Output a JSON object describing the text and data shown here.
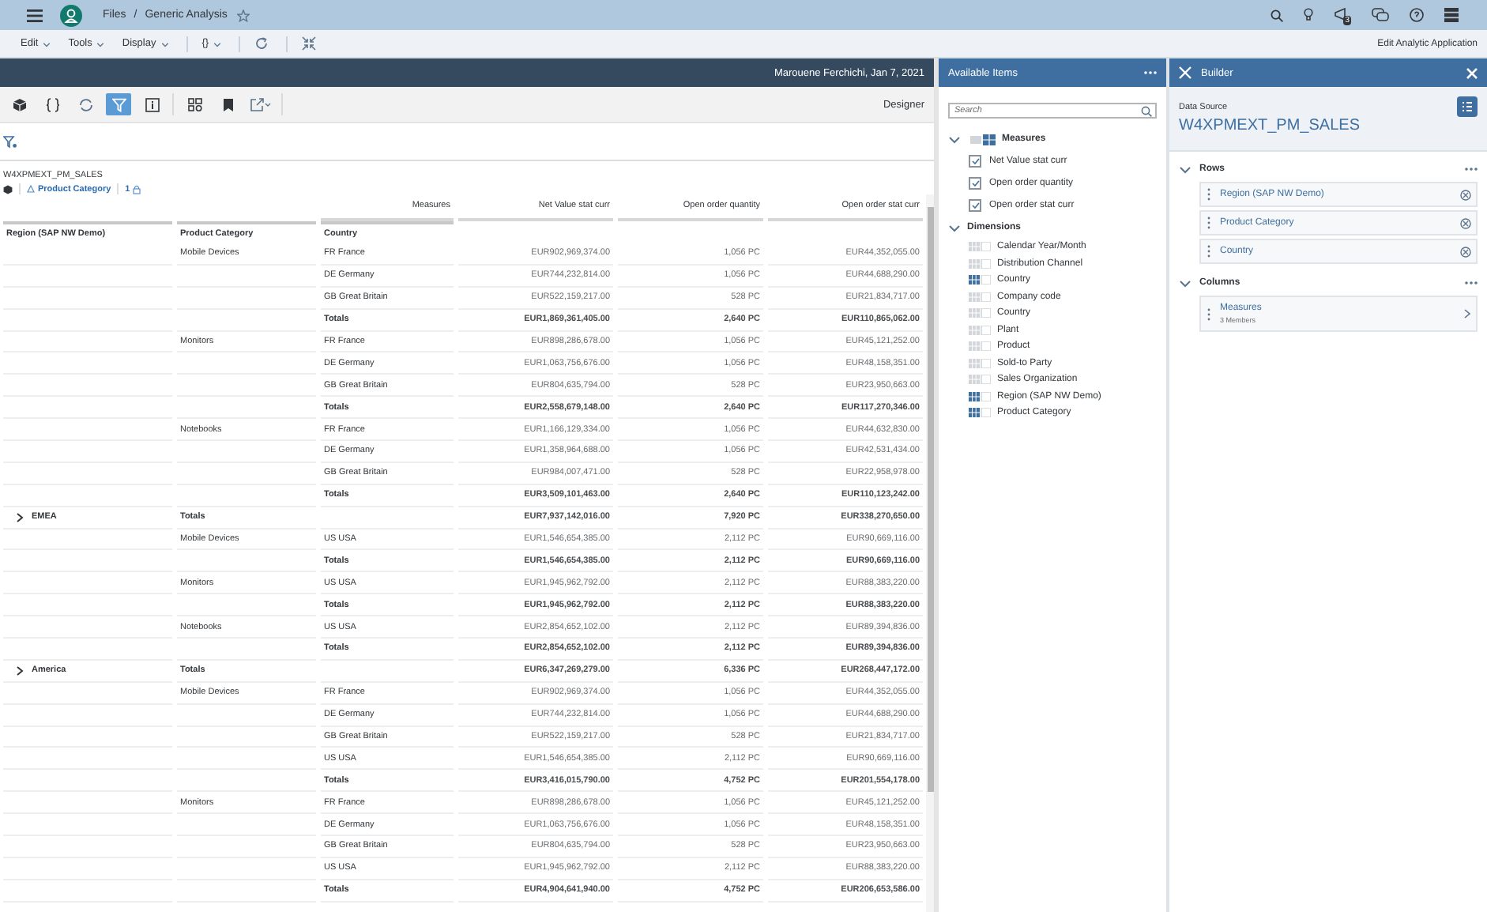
{
  "shell": {
    "breadcrumb": [
      "Files",
      "Generic Analysis"
    ],
    "separator": "/",
    "notification_count": "3"
  },
  "menu_bar": {
    "items": [
      {
        "label": "Edit",
        "kind": "dropdown"
      },
      {
        "label": "Tools",
        "kind": "dropdown"
      },
      {
        "label": "Display",
        "kind": "dropdown"
      },
      {
        "label": "{}",
        "kind": "dropdown"
      },
      {
        "kind": "refresh"
      },
      {
        "kind": "fullscreen"
      }
    ],
    "right_link": "Edit Analytic Application"
  },
  "header_bar": {
    "text": "Marouene Ferchichi, Jan 7, 2021"
  },
  "toolbar": {
    "items": [
      {
        "kind": "cube",
        "selected": false
      },
      {
        "kind": "braces",
        "selected": false
      },
      {
        "kind": "refresh",
        "selected": false
      },
      {
        "kind": "filter",
        "selected": true
      },
      {
        "kind": "info",
        "selected": false
      },
      {
        "kind": "grid",
        "selected": false
      },
      {
        "kind": "bookmark",
        "selected": false
      },
      {
        "kind": "share",
        "selected": false
      }
    ],
    "designer_link": "Designer"
  },
  "table": {
    "source": "W4XPMEXT_PM_SALES",
    "filter_chip": "Product Category",
    "filter_count": "1",
    "measures_label": "Measures",
    "measure_columns": [
      "Net Value stat curr",
      "Open order quantity",
      "Open order stat curr"
    ],
    "dimension_columns": [
      "Region (SAP NW Demo)",
      "Product Category",
      "Country"
    ],
    "rows": [
      {
        "kind": "detail",
        "region": "",
        "category": "Mobile Devices",
        "country": "FR France",
        "values": [
          "EUR902,969,374.00",
          "1,056 PC",
          "EUR44,352,055.00"
        ]
      },
      {
        "kind": "detail",
        "region": "",
        "category": "",
        "country": "DE Germany",
        "values": [
          "EUR744,232,814.00",
          "1,056 PC",
          "EUR44,688,290.00"
        ]
      },
      {
        "kind": "detail",
        "region": "",
        "category": "",
        "country": "GB Great Britain",
        "values": [
          "EUR522,159,217.00",
          "528 PC",
          "EUR21,834,717.00"
        ]
      },
      {
        "kind": "total",
        "region": "",
        "category": "",
        "country": "Totals",
        "values": [
          "EUR1,869,361,405.00",
          "2,640 PC",
          "EUR110,865,062.00"
        ]
      },
      {
        "kind": "detail",
        "region": "",
        "category": "Monitors",
        "country": "FR France",
        "values": [
          "EUR898,286,678.00",
          "1,056 PC",
          "EUR45,121,252.00"
        ]
      },
      {
        "kind": "detail",
        "region": "",
        "category": "",
        "country": "DE Germany",
        "values": [
          "EUR1,063,756,676.00",
          "1,056 PC",
          "EUR48,158,351.00"
        ]
      },
      {
        "kind": "detail",
        "region": "",
        "category": "",
        "country": "GB Great Britain",
        "values": [
          "EUR804,635,794.00",
          "528 PC",
          "EUR23,950,663.00"
        ]
      },
      {
        "kind": "total",
        "region": "",
        "category": "",
        "country": "Totals",
        "values": [
          "EUR2,558,679,148.00",
          "2,640 PC",
          "EUR117,270,346.00"
        ]
      },
      {
        "kind": "detail",
        "region": "",
        "category": "Notebooks",
        "country": "FR France",
        "values": [
          "EUR1,166,129,334.00",
          "1,056 PC",
          "EUR44,632,830.00"
        ]
      },
      {
        "kind": "detail",
        "region": "",
        "category": "",
        "country": "DE Germany",
        "values": [
          "EUR1,358,964,688.00",
          "1,056 PC",
          "EUR42,531,434.00"
        ]
      },
      {
        "kind": "detail",
        "region": "",
        "category": "",
        "country": "GB Great Britain",
        "values": [
          "EUR984,007,471.00",
          "528 PC",
          "EUR22,958,978.00"
        ]
      },
      {
        "kind": "total",
        "region": "",
        "category": "",
        "country": "Totals",
        "values": [
          "EUR3,509,101,463.00",
          "2,640 PC",
          "EUR110,123,242.00"
        ]
      },
      {
        "kind": "region",
        "region": "EMEA",
        "category": "Totals",
        "country": "",
        "values": [
          "EUR7,937,142,016.00",
          "7,920 PC",
          "EUR338,270,650.00"
        ]
      },
      {
        "kind": "detail",
        "region": "",
        "category": "Mobile Devices",
        "country": "US USA",
        "values": [
          "EUR1,546,654,385.00",
          "2,112 PC",
          "EUR90,669,116.00"
        ]
      },
      {
        "kind": "total",
        "region": "",
        "category": "",
        "country": "Totals",
        "values": [
          "EUR1,546,654,385.00",
          "2,112 PC",
          "EUR90,669,116.00"
        ]
      },
      {
        "kind": "detail",
        "region": "",
        "category": "Monitors",
        "country": "US USA",
        "values": [
          "EUR1,945,962,792.00",
          "2,112 PC",
          "EUR88,383,220.00"
        ]
      },
      {
        "kind": "total",
        "region": "",
        "category": "",
        "country": "Totals",
        "values": [
          "EUR1,945,962,792.00",
          "2,112 PC",
          "EUR88,383,220.00"
        ]
      },
      {
        "kind": "detail",
        "region": "",
        "category": "Notebooks",
        "country": "US USA",
        "values": [
          "EUR2,854,652,102.00",
          "2,112 PC",
          "EUR89,394,836.00"
        ]
      },
      {
        "kind": "total",
        "region": "",
        "category": "",
        "country": "Totals",
        "values": [
          "EUR2,854,652,102.00",
          "2,112 PC",
          "EUR89,394,836.00"
        ]
      },
      {
        "kind": "region",
        "region": "America",
        "category": "Totals",
        "country": "",
        "values": [
          "EUR6,347,269,279.00",
          "6,336 PC",
          "EUR268,447,172.00"
        ]
      },
      {
        "kind": "detail",
        "region": "",
        "category": "Mobile Devices",
        "country": "FR France",
        "values": [
          "EUR902,969,374.00",
          "1,056 PC",
          "EUR44,352,055.00"
        ]
      },
      {
        "kind": "detail",
        "region": "",
        "category": "",
        "country": "DE Germany",
        "values": [
          "EUR744,232,814.00",
          "1,056 PC",
          "EUR44,688,290.00"
        ]
      },
      {
        "kind": "detail",
        "region": "",
        "category": "",
        "country": "GB Great Britain",
        "values": [
          "EUR522,159,217.00",
          "528 PC",
          "EUR21,834,717.00"
        ]
      },
      {
        "kind": "detail",
        "region": "",
        "category": "",
        "country": "US USA",
        "values": [
          "EUR1,546,654,385.00",
          "2,112 PC",
          "EUR90,669,116.00"
        ]
      },
      {
        "kind": "total",
        "region": "",
        "category": "",
        "country": "Totals",
        "values": [
          "EUR3,416,015,790.00",
          "4,752 PC",
          "EUR201,554,178.00"
        ]
      },
      {
        "kind": "detail",
        "region": "",
        "category": "Monitors",
        "country": "FR France",
        "values": [
          "EUR898,286,678.00",
          "1,056 PC",
          "EUR45,121,252.00"
        ]
      },
      {
        "kind": "detail",
        "region": "",
        "category": "",
        "country": "DE Germany",
        "values": [
          "EUR1,063,756,676.00",
          "1,056 PC",
          "EUR48,158,351.00"
        ]
      },
      {
        "kind": "detail",
        "region": "",
        "category": "",
        "country": "GB Great Britain",
        "values": [
          "EUR804,635,794.00",
          "528 PC",
          "EUR23,950,663.00"
        ]
      },
      {
        "kind": "detail",
        "region": "",
        "category": "",
        "country": "US USA",
        "values": [
          "EUR1,945,962,792.00",
          "2,112 PC",
          "EUR88,383,220.00"
        ]
      },
      {
        "kind": "total",
        "region": "",
        "category": "",
        "country": "Totals",
        "values": [
          "EUR4,904,641,940.00",
          "4,752 PC",
          "EUR206,653,586.00"
        ]
      }
    ]
  },
  "available_items": {
    "title": "Available Items",
    "search": {
      "placeholder": "Search"
    },
    "measures": {
      "label": "Measures",
      "expanded": true,
      "items": [
        {
          "label": "Net Value stat curr",
          "checked": true
        },
        {
          "label": "Open order quantity",
          "checked": true
        },
        {
          "label": "Open order stat curr",
          "checked": true
        }
      ]
    },
    "dimensions": {
      "label": "Dimensions",
      "expanded": true,
      "items": [
        {
          "label": "Calendar Year/Month",
          "used": false
        },
        {
          "label": "Distribution Channel",
          "used": false
        },
        {
          "label": "Country",
          "used": true
        },
        {
          "label": "Company code",
          "used": false
        },
        {
          "label": "Country",
          "used": false
        },
        {
          "label": "Plant",
          "used": false
        },
        {
          "label": "Product",
          "used": false
        },
        {
          "label": "Sold-to Party",
          "used": false
        },
        {
          "label": "Sales Organization",
          "used": false
        },
        {
          "label": "Region (SAP NW Demo)",
          "used": true
        },
        {
          "label": "Product Category",
          "used": true
        }
      ]
    }
  },
  "builder": {
    "title": "Builder",
    "data_source_label": "Data Source",
    "data_source": "W4XPMEXT_PM_SALES",
    "sections": [
      {
        "label": "Rows",
        "expanded": true,
        "items": [
          {
            "label": "Region (SAP NW Demo)",
            "kind": "removable"
          },
          {
            "label": "Product Category",
            "kind": "removable"
          },
          {
            "label": "Country",
            "kind": "removable"
          }
        ]
      },
      {
        "label": "Columns",
        "expanded": true,
        "items": [
          {
            "label": "Measures",
            "sublabel": "3 Members",
            "kind": "navigable"
          }
        ]
      }
    ]
  }
}
